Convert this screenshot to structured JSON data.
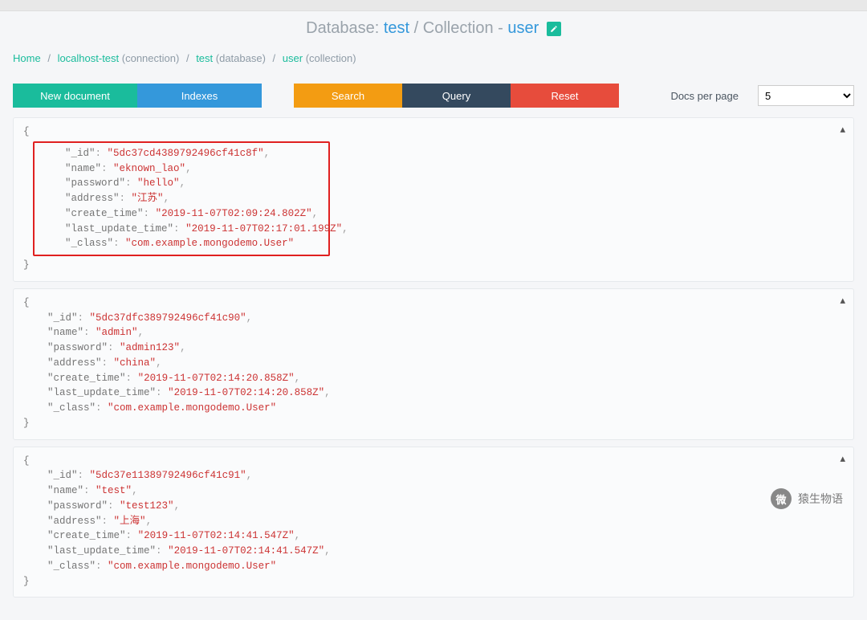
{
  "header": {
    "prefix": "Database: ",
    "database": "test",
    "mid": " / Collection - ",
    "collection": "user"
  },
  "breadcrumb": {
    "home": "Home",
    "connection": "localhost-test",
    "connection_suffix": " (connection)",
    "database": "test",
    "database_suffix": " (database)",
    "collection": "user",
    "collection_suffix": " (collection)"
  },
  "buttons": {
    "new_document": "New document",
    "indexes": "Indexes",
    "search": "Search",
    "query": "Query",
    "reset": "Reset"
  },
  "docs_per_page": {
    "label": "Docs per page",
    "value": "5"
  },
  "documents": [
    {
      "highlighted": true,
      "_id": "5dc37cd4389792496cf41c8f",
      "name": "eknown_lao",
      "password": "hello",
      "address": "江苏",
      "create_time": "2019-11-07T02:09:24.802Z",
      "last_update_time": "2019-11-07T02:17:01.199Z",
      "_class": "com.example.mongodemo.User"
    },
    {
      "highlighted": false,
      "_id": "5dc37dfc389792496cf41c90",
      "name": "admin",
      "password": "admin123",
      "address": "china",
      "create_time": "2019-11-07T02:14:20.858Z",
      "last_update_time": "2019-11-07T02:14:20.858Z",
      "_class": "com.example.mongodemo.User"
    },
    {
      "highlighted": false,
      "_id": "5dc37e11389792496cf41c91",
      "name": "test",
      "password": "test123",
      "address": "上海",
      "create_time": "2019-11-07T02:14:41.547Z",
      "last_update_time": "2019-11-07T02:14:41.547Z",
      "_class": "com.example.mongodemo.User"
    }
  ],
  "watermark": {
    "icon": "微",
    "text": "猿生物语"
  }
}
